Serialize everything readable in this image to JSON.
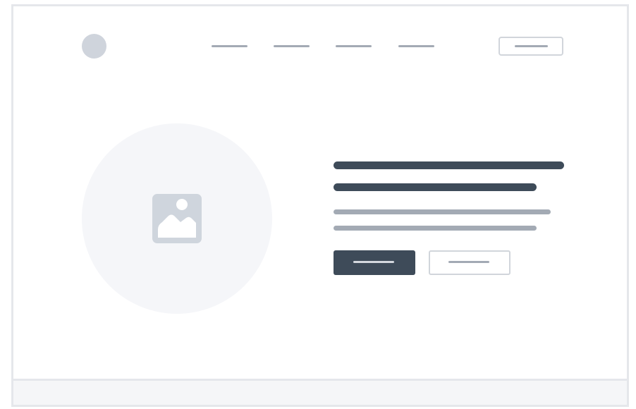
{
  "colors": {
    "frame_border": "#e5e7eb",
    "footer_bg": "#f5f6f8",
    "logo": "#cfd4dc",
    "nav_line": "#a3aab4",
    "image_bg": "#f5f6f9",
    "image_icon": "#cfd5dd",
    "heading": "#3e4b59",
    "body_text": "#a3aab4",
    "primary_button": "#3e4b59",
    "primary_button_line": "#d4d8de",
    "secondary_button_border": "#d1d5db",
    "secondary_button_line": "#a3aab4"
  },
  "icons": {
    "logo": "circle-logo",
    "hero": "image-placeholder-icon"
  },
  "nav": {
    "link_count": 4
  }
}
